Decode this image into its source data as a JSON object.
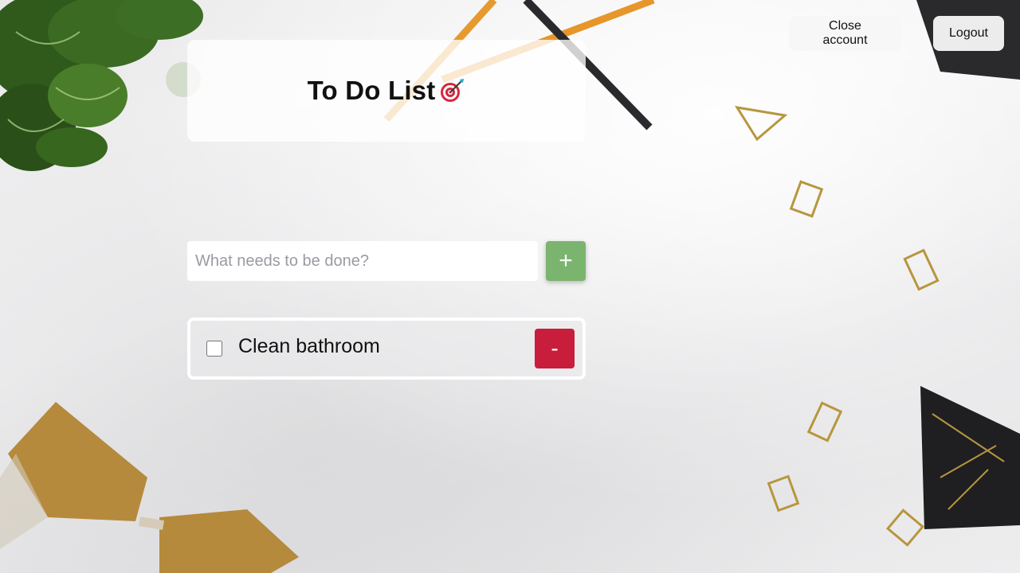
{
  "header": {
    "close_account_label": "Close account",
    "logout_label": "Logout"
  },
  "title_card": {
    "title": "To Do List",
    "icon": "target-dart-icon"
  },
  "add_task": {
    "placeholder": "What needs to be done?",
    "value": "",
    "add_label": "+"
  },
  "todos": [
    {
      "text": "Clean bathroom",
      "checked": false,
      "remove_label": "-"
    }
  ],
  "colors": {
    "add_button": "#7ab46f",
    "remove_button": "#c81e3c",
    "card_border": "#ffffff"
  }
}
